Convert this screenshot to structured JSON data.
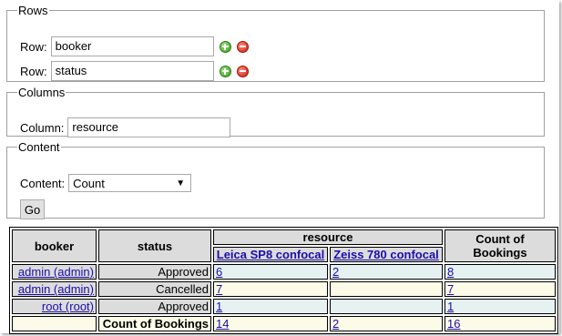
{
  "rows_section": {
    "legend": "Rows",
    "rows": [
      {
        "label": "Row:",
        "value": "booker"
      },
      {
        "label": "Row:",
        "value": "status"
      }
    ]
  },
  "columns_section": {
    "legend": "Columns",
    "label": "Column:",
    "value": "resource"
  },
  "content_section": {
    "legend": "Content",
    "label": "Content:",
    "selected": "Count",
    "go_label": "Go"
  },
  "table": {
    "h_booker": "booker",
    "h_status": "status",
    "h_resource": "resource",
    "h_count": "Count of Bookings",
    "col1": "Leica SP8 confocal",
    "col2": "Zeiss 780 confocal",
    "rows": [
      {
        "booker": "admin (admin)",
        "status": "Approved",
        "c1": "6",
        "c2": "2",
        "total": "8"
      },
      {
        "booker": "admin (admin)",
        "status": "Cancelled",
        "c1": "7",
        "c2": "",
        "total": "7"
      },
      {
        "booker": "root (root)",
        "status": "Approved",
        "c1": "1",
        "c2": "",
        "total": "1"
      }
    ],
    "footer": {
      "label": "Count of Bookings",
      "c1": "14",
      "c2": "2",
      "total": "16"
    }
  },
  "colors": {
    "row_blue": "#e6f2f2",
    "row_cream": "#fbfbe8",
    "header_gray": "#dcdcdc",
    "link": "#1a0dab"
  }
}
